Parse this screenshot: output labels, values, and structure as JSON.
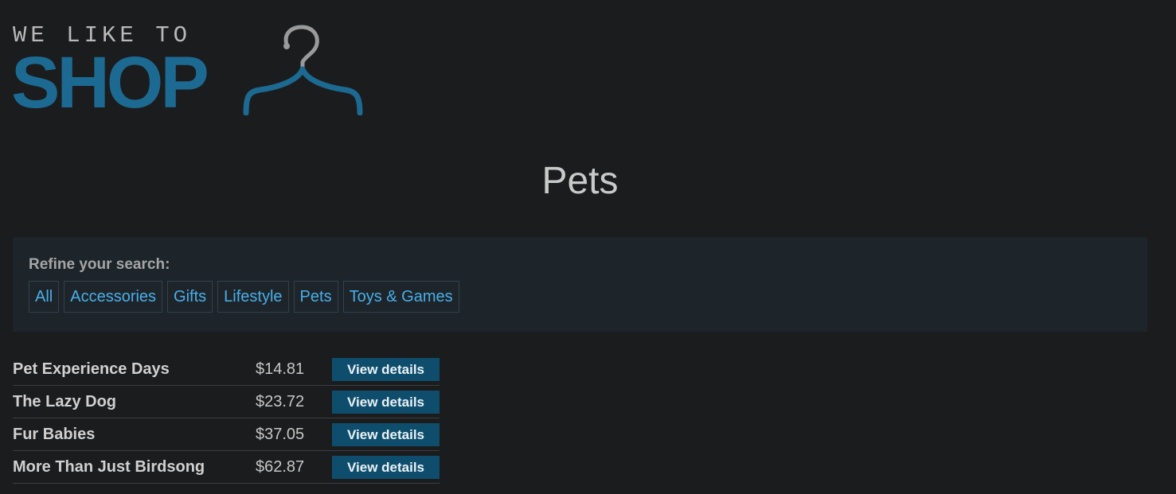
{
  "logo": {
    "tagline": "WE LIKE TO",
    "word": "SHOP",
    "icon": "hanger-icon",
    "accent_color": "#1c6a91"
  },
  "page": {
    "title": "Pets"
  },
  "refine": {
    "label": "Refine your search:",
    "links": [
      {
        "label": "All"
      },
      {
        "label": "Accessories"
      },
      {
        "label": "Gifts"
      },
      {
        "label": "Lifestyle"
      },
      {
        "label": "Pets"
      },
      {
        "label": "Toys & Games"
      }
    ]
  },
  "products": [
    {
      "name": "Pet Experience Days",
      "price": "$14.81",
      "button": "View details"
    },
    {
      "name": "The Lazy Dog",
      "price": "$23.72",
      "button": "View details"
    },
    {
      "name": "Fur Babies",
      "price": "$37.05",
      "button": "View details"
    },
    {
      "name": "More Than Just Birdsong",
      "price": "$62.87",
      "button": "View details"
    }
  ],
  "colors": {
    "background": "#1b1c1e",
    "panel": "#1d252b",
    "link": "#4aaee8",
    "button": "#0f4d6c"
  }
}
